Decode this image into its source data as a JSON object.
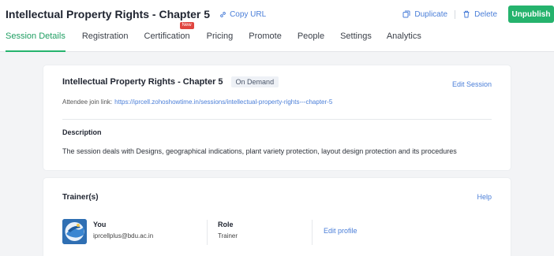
{
  "header": {
    "title": "Intellectual Property Rights - Chapter 5",
    "copy_url": "Copy URL",
    "duplicate": "Duplicate",
    "delete": "Delete",
    "unpublish": "Unpublish"
  },
  "tabs": [
    {
      "label": "Session Details",
      "active": true
    },
    {
      "label": "Registration"
    },
    {
      "label": "Certification",
      "badge": "New"
    },
    {
      "label": "Pricing"
    },
    {
      "label": "Promote"
    },
    {
      "label": "People"
    },
    {
      "label": "Settings"
    },
    {
      "label": "Analytics"
    }
  ],
  "session": {
    "name": "Intellectual Property Rights - Chapter 5",
    "type_badge": "On Demand",
    "edit_label": "Edit Session",
    "join_label": "Attendee join link:",
    "join_link": "https://iprcell.zohoshowtime.in/sessions/intellectual-property-rights---chapter-5",
    "description_heading": "Description",
    "description": "The session deals with Designs, geographical indications, plant variety protection, layout design protection and its procedures"
  },
  "trainers": {
    "heading": "Trainer(s)",
    "help": "Help",
    "name": "You",
    "email": "iprcellplus@bdu.ac.in",
    "role_heading": "Role",
    "role": "Trainer",
    "edit_profile": "Edit profile"
  },
  "colors": {
    "accent_green": "#25b36d",
    "link_blue": "#4a7ed8",
    "new_badge": "#e0453f"
  }
}
